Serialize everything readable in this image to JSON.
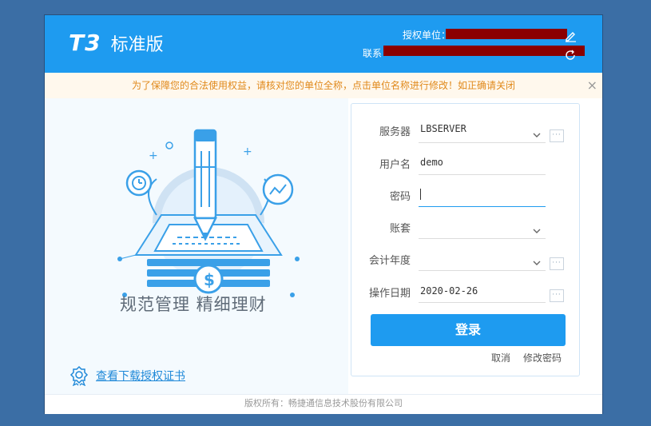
{
  "header": {
    "logo_brand": "T3",
    "logo_edition": "标准版",
    "authorized_unit_label": "授权单位：",
    "contact_label": "联系"
  },
  "notice": {
    "text": "为了保障您的合法使用权益，请核对您的单位全称，点击单位名称进行修改！如正确请关闭",
    "close_glyph": "×"
  },
  "illustration": {
    "slogan": "规范管理  精细理财",
    "cert_link": "查看下载授权证书"
  },
  "login": {
    "server": {
      "label": "服务器",
      "value": "LBSERVER"
    },
    "username": {
      "label": "用户名",
      "value": "demo"
    },
    "password": {
      "label": "密码",
      "value": ""
    },
    "account_set": {
      "label": "账套",
      "value": ""
    },
    "fiscal_year": {
      "label": "会计年度",
      "value": ""
    },
    "operation_date": {
      "label": "操作日期",
      "value": "2020-02-26"
    },
    "more_glyph": "···",
    "login_button": "登录",
    "cancel_link": "取消",
    "change_password_link": "修改密码"
  },
  "footer": {
    "copyright": "版权所有：畅捷通信息技术股份有限公司"
  },
  "colors": {
    "header_blue": "#1e9bf0",
    "desktop_blue": "#3b6ea5",
    "notice_text": "#e0891b",
    "redaction": "#8b0000"
  }
}
